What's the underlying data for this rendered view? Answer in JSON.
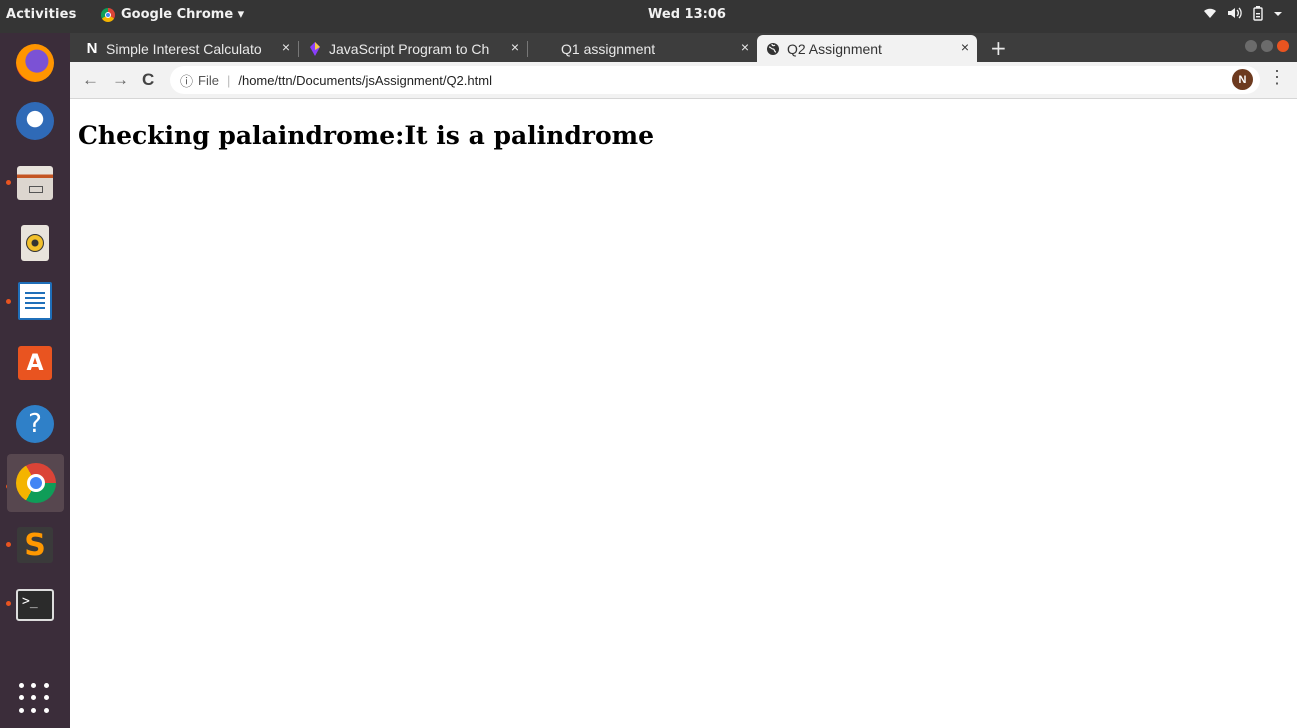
{
  "system_bar": {
    "activities": "Activities",
    "app_name": "Google Chrome ▾",
    "clock": "Wed 13:06",
    "tray_icons": [
      "wifi-icon",
      "volume-icon",
      "battery-icon",
      "chevron-down-icon"
    ]
  },
  "dock": {
    "items": [
      {
        "name": "firefox",
        "running": false
      },
      {
        "name": "thunderbird",
        "running": false
      },
      {
        "name": "files",
        "running": true
      },
      {
        "name": "rhythmbox",
        "running": false
      },
      {
        "name": "libreoffice-writer",
        "running": true
      },
      {
        "name": "ubuntu-software",
        "running": false
      },
      {
        "name": "help",
        "running": false
      },
      {
        "name": "chrome",
        "running": true,
        "active": true
      },
      {
        "name": "sublime-text",
        "running": true
      },
      {
        "name": "terminal",
        "running": true
      }
    ],
    "store_glyph": "A",
    "help_glyph": "?",
    "sublime_glyph": "S",
    "terminal_glyph": ">_"
  },
  "tabs": [
    {
      "title": "Simple Interest Calculato",
      "favicon": "N",
      "active": false
    },
    {
      "title": "JavaScript Program to Ch",
      "favicon": "js-icon",
      "active": false
    },
    {
      "title": "Q1 assignment",
      "favicon": "",
      "active": false
    },
    {
      "title": "Q2 Assignment",
      "favicon": "globe-icon",
      "active": true
    }
  ],
  "tab_close": "×",
  "new_tab": "+",
  "toolbar": {
    "back": "←",
    "forward": "→",
    "reload": "C",
    "info": "ⓘ",
    "scheme": "File",
    "url": "/home/ttn/Documents/jsAssignment/Q2.html",
    "star": "☆",
    "profile_initial": "N",
    "menu": "⋮"
  },
  "page": {
    "heading": "Checking palaindrome:It is a palindrome"
  }
}
